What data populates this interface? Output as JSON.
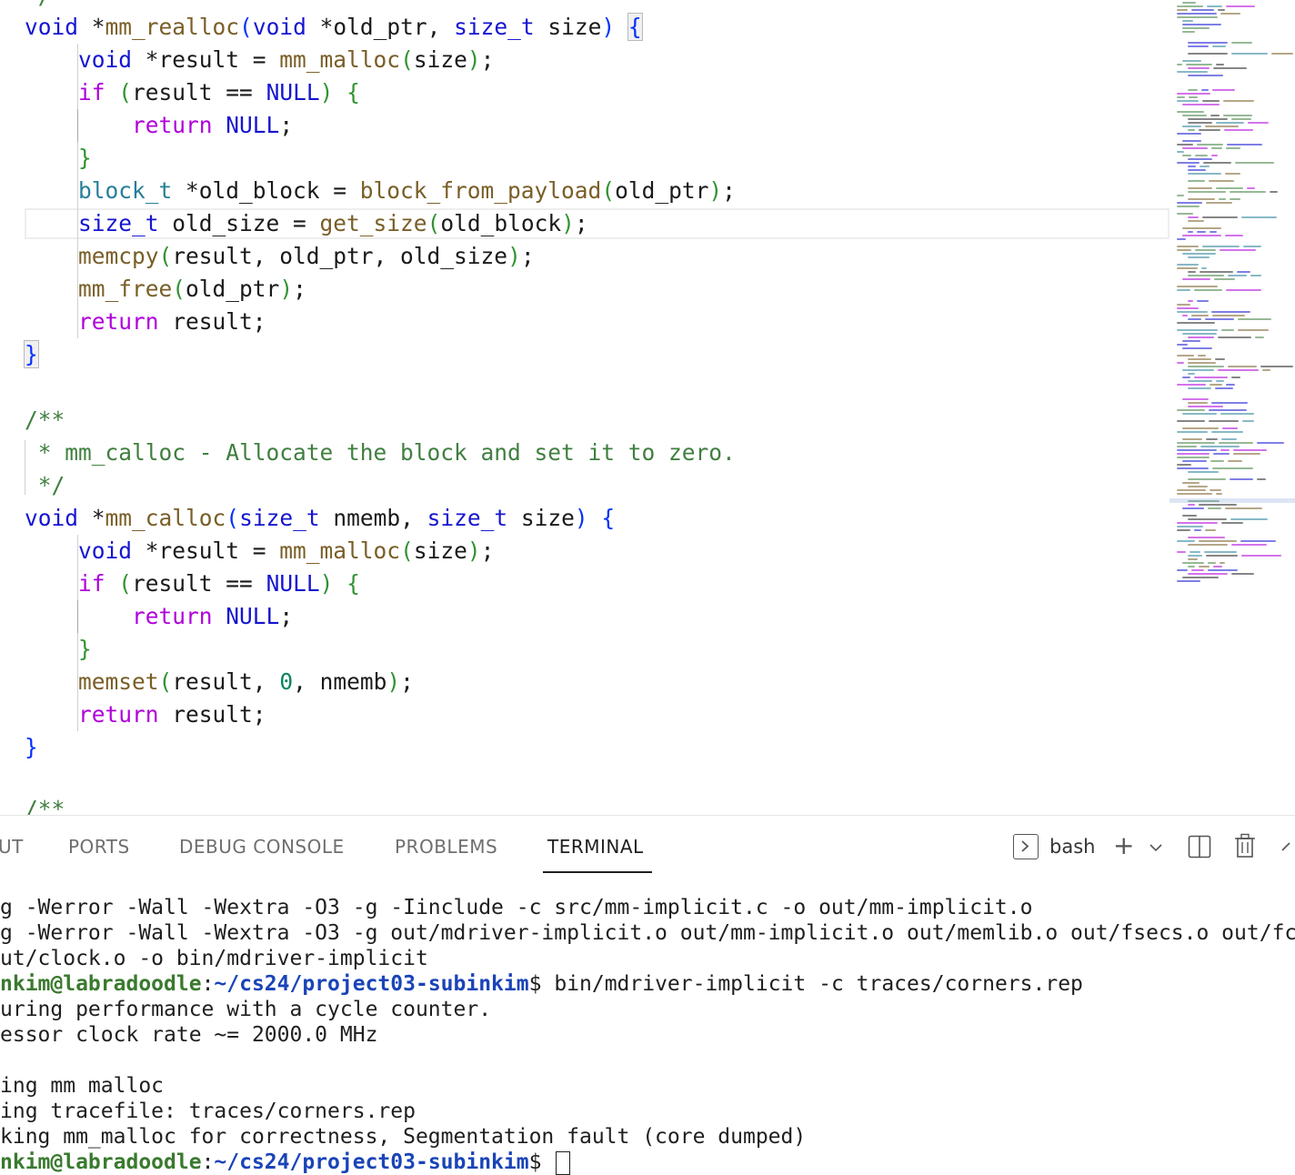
{
  "editor": {
    "realloc_sig": {
      "ret": "void",
      "star": " *",
      "name": "mm_realloc",
      "open": "(",
      "p1t": "void",
      "p1n": " *old_ptr, ",
      "p2t": "size_t",
      "p2n": " size",
      "close": ")",
      "brace": "{"
    },
    "realloc_body": {
      "l1": {
        "t": "void",
        "rest": " *result = ",
        "fn": "mm_malloc",
        "args": "size",
        "end": ";"
      },
      "l2": {
        "kw": "if",
        "open": " (",
        "mid": "result == ",
        "null": "NULL",
        "close": ") ",
        "brace": "{"
      },
      "l3": {
        "kw": "return",
        "sp": " ",
        "null": "NULL",
        "end": ";"
      },
      "l4": {
        "brace": "}"
      },
      "l5": {
        "t": "block_t",
        "rest": " *old_block = ",
        "fn": "block_from_payload",
        "args": "old_ptr",
        "end": ";"
      },
      "l6": {
        "t": "size_t",
        "rest": " old_size = ",
        "fn": "get_size",
        "args": "old_block",
        "end": ";"
      },
      "l7": {
        "fn": "memcpy",
        "args": "result, old_ptr, old_size",
        "end": ";"
      },
      "l8": {
        "fn": "mm_free",
        "args": "old_ptr",
        "end": ";"
      },
      "l9": {
        "kw": "return",
        "rest": " result;"
      },
      "l10": {
        "brace": "}"
      }
    },
    "comment": {
      "c1": "/**",
      "c2": " * mm_calloc - Allocate the block and set it to zero.",
      "c3": " */",
      "c4": "/**"
    },
    "calloc_sig": {
      "ret": "void",
      "star": " *",
      "name": "mm_calloc",
      "open": "(",
      "p1t": "size_t",
      "p1n": " nmemb, ",
      "p2t": "size_t",
      "p2n": " size",
      "close": ")",
      "brace": "{"
    },
    "calloc_body": {
      "l1": {
        "t": "void",
        "rest": " *result = ",
        "fn": "mm_malloc",
        "args": "size",
        "end": ";"
      },
      "l2": {
        "kw": "if",
        "open": " (",
        "mid": "result == ",
        "null": "NULL",
        "close": ") ",
        "brace": "{"
      },
      "l3": {
        "kw": "return",
        "sp": " ",
        "null": "NULL",
        "end": ";"
      },
      "l4": {
        "brace": "}"
      },
      "l5": {
        "fn": "memset",
        "a1": "result, ",
        "zero": "0",
        "a2": ", nmemb",
        "end": ";"
      },
      "l6": {
        "kw": "return",
        "rest": " result;"
      },
      "l7": {
        "brace": "}"
      }
    }
  },
  "panel": {
    "tabs": [
      "UT",
      "PORTS",
      "DEBUG CONSOLE",
      "PROBLEMS",
      "TERMINAL"
    ],
    "shell": "bash"
  },
  "terminal": {
    "t1": "g -Werror -Wall -Wextra -O3 -g -Iinclude -c src/mm-implicit.c -o out/mm-implicit.o",
    "t2": "g -Werror -Wall -Wextra -O3 -g out/mdriver-implicit.o out/mm-implicit.o out/memlib.o out/fsecs.o out/fc",
    "t3": "ut/clock.o -o bin/mdriver-implicit",
    "prompt_user": "nkim@labradoodle",
    "prompt_colon": ":",
    "prompt_path": "~/cs24/project03-subinkim",
    "prompt_dollar": "$ ",
    "cmd": "bin/mdriver-implicit -c traces/corners.rep",
    "t5": "uring performance with a cycle counter.",
    "t6": "essor clock rate ~= 2000.0 MHz",
    "t7": "ing mm malloc",
    "t8": "ing tracefile: traces/corners.rep",
    "t9": "king mm_malloc for correctness, Segmentation fault (core dumped)"
  },
  "colors": {
    "keyword": "#1515d0",
    "control": "#af00db",
    "function": "#795e26",
    "type": "#267f99",
    "comment": "#3f7f3f",
    "prompt_user": "#3a7a2f",
    "prompt_path": "#1a44b8"
  }
}
